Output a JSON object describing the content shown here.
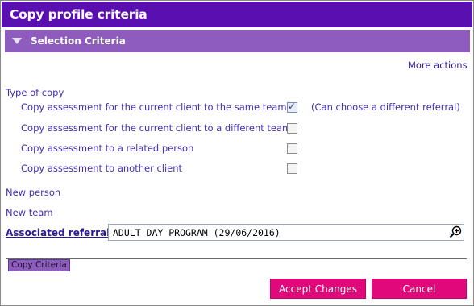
{
  "window": {
    "title": "Copy profile criteria"
  },
  "section": {
    "title": "Selection Criteria"
  },
  "more_actions": "More actions",
  "type_of_copy": {
    "label": "Type of copy",
    "options": [
      {
        "label": "Copy assessment for the current client to the same team",
        "checked": true
      },
      {
        "label": "Copy assessment for the current client to a different team",
        "checked": false
      },
      {
        "label": "Copy assessment to a related person",
        "checked": false
      },
      {
        "label": "Copy assessment to another client",
        "checked": false
      }
    ],
    "note": "(Can choose a different referral)"
  },
  "new_person_label": "New person",
  "new_team_label": "New team",
  "associated_referral": {
    "label": "Associated referral",
    "value": "ADULT DAY PROGRAM (29/06/2016)",
    "search_icon": "magnifier-plus-icon"
  },
  "tab": {
    "label": "Copy Criteria"
  },
  "buttons": {
    "accept": "Accept Changes",
    "cancel": "Cancel"
  },
  "colors": {
    "title_bar": "#5a0fb0",
    "section_header": "#8d5cbc",
    "button": "#e0087a",
    "text": "#3f2fb5"
  }
}
